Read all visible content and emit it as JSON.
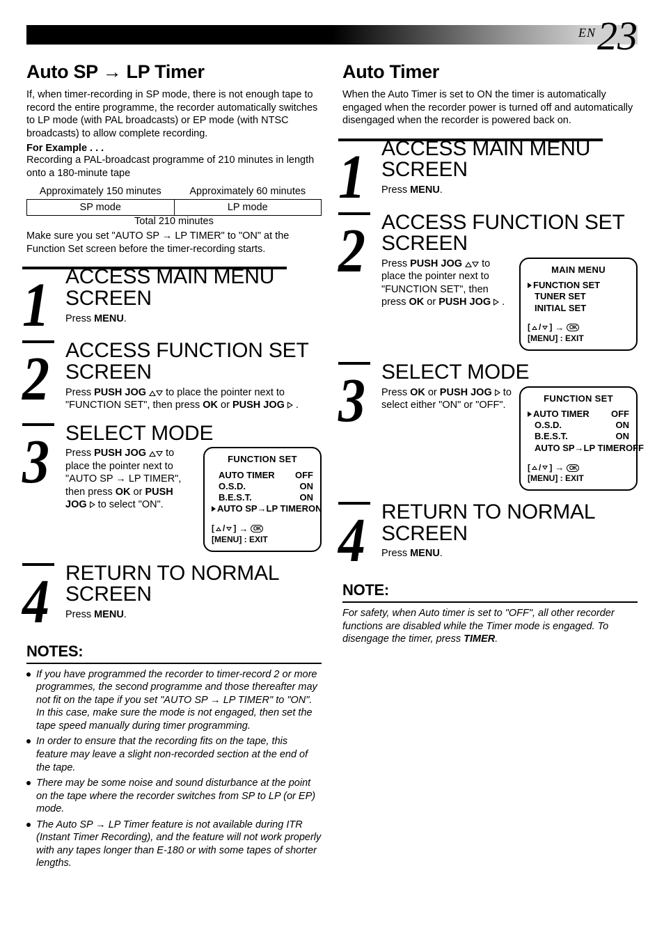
{
  "page": {
    "en": "EN",
    "num": "23"
  },
  "left": {
    "h1": "Auto SP → LP Timer",
    "intro": "If, when timer-recording in SP mode, there is not enough tape to record the entire programme, the recorder automatically switches to LP mode (with PAL broadcasts) or EP mode (with NTSC broadcasts) to allow complete recording.",
    "for_example": "For Example . . .",
    "example_line": "Recording a PAL-broadcast programme of 210 minutes in length onto a 180-minute tape",
    "table": {
      "t1": "Approximately 150 minutes",
      "t2": "Approximately 60 minutes",
      "sp": "SP mode",
      "lp": "LP mode",
      "total": "Total 210 minutes"
    },
    "post_table": "Make sure you set \"AUTO SP → LP TIMER\" to \"ON\" at the Function Set screen before the timer-recording starts.",
    "steps": [
      {
        "num": "1",
        "title": "ACCESS MAIN MENU SCREEN",
        "body": [
          [
            "Press ",
            [
              "b",
              "MENU"
            ],
            "."
          ]
        ]
      },
      {
        "num": "2",
        "title": "ACCESS FUNCTION SET SCREEN",
        "body": [
          [
            "Press ",
            [
              "b",
              "PUSH JOG"
            ],
            " ",
            [
              "up"
            ],
            [
              "down"
            ],
            " to place the pointer next to \"FUNCTION SET\", then press ",
            [
              "b",
              "OK"
            ],
            " or ",
            [
              "b",
              "PUSH JOG"
            ],
            " ",
            [
              "right"
            ],
            " ."
          ]
        ]
      },
      {
        "num": "3",
        "title": "SELECT MODE",
        "body": [
          [
            "Press ",
            [
              "b",
              "PUSH JOG"
            ],
            " ",
            [
              "up"
            ],
            [
              "down"
            ],
            " to place the pointer next to \"AUTO SP → LP TIMER\", then press ",
            [
              "b",
              "OK"
            ],
            " or ",
            [
              "b",
              "PUSH JOG"
            ],
            " ",
            [
              "right"
            ],
            " to select \"ON\"."
          ]
        ],
        "osd": {
          "title": "FUNCTION SET",
          "rows": [
            {
              "l": "AUTO TIMER",
              "r": "OFF"
            },
            {
              "l": "O.S.D.",
              "r": "ON"
            },
            {
              "l": "B.E.S.T.",
              "r": "ON"
            },
            {
              "l": "AUTO SP→LP TIMER",
              "r": "ON",
              "cursor": true
            }
          ],
          "hint1": "[▲/▼] →",
          "hint2": "[MENU] : EXIT"
        }
      },
      {
        "num": "4",
        "title": "RETURN TO NORMAL SCREEN",
        "body": [
          [
            "Press ",
            [
              "b",
              "MENU"
            ],
            "."
          ]
        ]
      }
    ],
    "notes_h": "NOTES:",
    "notes": [
      "If you have programmed the recorder to timer-record 2 or more programmes, the second programme and those thereafter may not fit on the tape if you set \"AUTO SP → LP TIMER\" to \"ON\". In this case, make sure the mode is not engaged, then set the tape speed manually during timer programming.",
      "In order to ensure that the recording fits on the tape, this feature may leave a slight non-recorded section at the end of the tape.",
      "There may be some noise and sound disturbance at the point on the tape where the recorder switches from SP to LP (or EP) mode.",
      "The Auto SP → LP Timer feature is not available during ITR (Instant Timer Recording), and the feature will not work properly with any tapes longer than E-180 or with some tapes of shorter lengths."
    ]
  },
  "right": {
    "h1": "Auto Timer",
    "intro": "When the Auto Timer is set to ON the timer is automatically engaged when the recorder power is turned off and automatically disengaged when the recorder is powered back on.",
    "steps": [
      {
        "num": "1",
        "title": "ACCESS MAIN MENU SCREEN",
        "body": [
          [
            "Press ",
            [
              "b",
              "MENU"
            ],
            "."
          ]
        ]
      },
      {
        "num": "2",
        "title": "ACCESS FUNCTION SET SCREEN",
        "body": [
          [
            "Press ",
            [
              "b",
              "PUSH JOG"
            ],
            " ",
            [
              "up"
            ],
            [
              "down"
            ],
            " to place the pointer next to \"FUNCTION SET\", then press ",
            [
              "b",
              "OK"
            ],
            " or ",
            [
              "b",
              "PUSH JOG"
            ],
            " ",
            [
              "right"
            ],
            " ."
          ]
        ],
        "osd": {
          "title": "MAIN MENU",
          "rows": [
            {
              "l": "FUNCTION SET",
              "cursor": true
            },
            {
              "l": "TUNER SET"
            },
            {
              "l": "INITIAL SET"
            }
          ],
          "hint1": "[▲/▼] →",
          "hint2": "[MENU] : EXIT"
        }
      },
      {
        "num": "3",
        "title": "SELECT MODE",
        "body": [
          [
            "Press ",
            [
              "b",
              "OK"
            ],
            " or ",
            [
              "b",
              "PUSH JOG"
            ],
            " ",
            [
              "right"
            ],
            " to select either \"ON\" or \"OFF\"."
          ]
        ],
        "osd": {
          "title": "FUNCTION SET",
          "rows": [
            {
              "l": "AUTO TIMER",
              "r": "OFF",
              "cursor": true
            },
            {
              "l": "O.S.D.",
              "r": "ON"
            },
            {
              "l": "B.E.S.T.",
              "r": "ON"
            },
            {
              "l": "AUTO SP→LP TIMER",
              "r": "OFF"
            }
          ],
          "hint1": "[▲/▼] →",
          "hint2": "[MENU] : EXIT"
        }
      },
      {
        "num": "4",
        "title": "RETURN TO NORMAL SCREEN",
        "body": [
          [
            "Press ",
            [
              "b",
              "MENU"
            ],
            "."
          ]
        ]
      }
    ],
    "note_h": "NOTE:",
    "note_p_pre": "For safety, when Auto timer is set to \"OFF\", all other recorder functions are disabled while the Timer mode is engaged. To disengage the timer, press ",
    "note_p_b": "TIMER",
    "note_p_post": "."
  }
}
